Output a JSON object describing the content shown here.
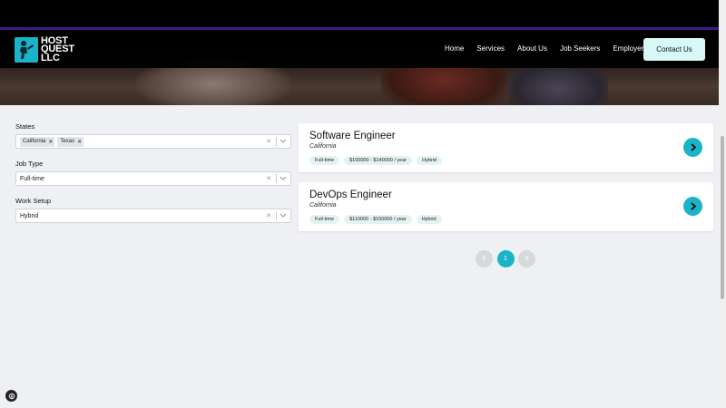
{
  "brand": {
    "line1": "HOST",
    "line2": "QUEST",
    "line3": "LLC"
  },
  "nav": {
    "items": [
      "Home",
      "Services",
      "About Us",
      "Job Seekers",
      "Employers"
    ],
    "contact_label": "Contact Us"
  },
  "filters": {
    "states": {
      "label": "States",
      "chips": [
        "California",
        "Texas"
      ]
    },
    "job_type": {
      "label": "Job Type",
      "value": "Full-time"
    },
    "work_setup": {
      "label": "Work Setup",
      "value": "Hybrid"
    }
  },
  "jobs": [
    {
      "title": "Software Engineer",
      "location": "California",
      "tags": [
        "Full-time",
        "$100000 - $140000 / year",
        "Hybrid"
      ]
    },
    {
      "title": "DevOps Engineer",
      "location": "California",
      "tags": [
        "Full-time",
        "$110000 - $150000 / year",
        "Hybrid"
      ]
    }
  ],
  "pagination": {
    "current": "1"
  },
  "colors": {
    "accent": "#1ab3c8",
    "nav_bg": "#000000",
    "contact_bg": "#d8f8f8"
  },
  "icons": {
    "close": "close-icon",
    "chevron_down": "chevron-down-icon",
    "arrow_right": "arrow-right-icon"
  }
}
